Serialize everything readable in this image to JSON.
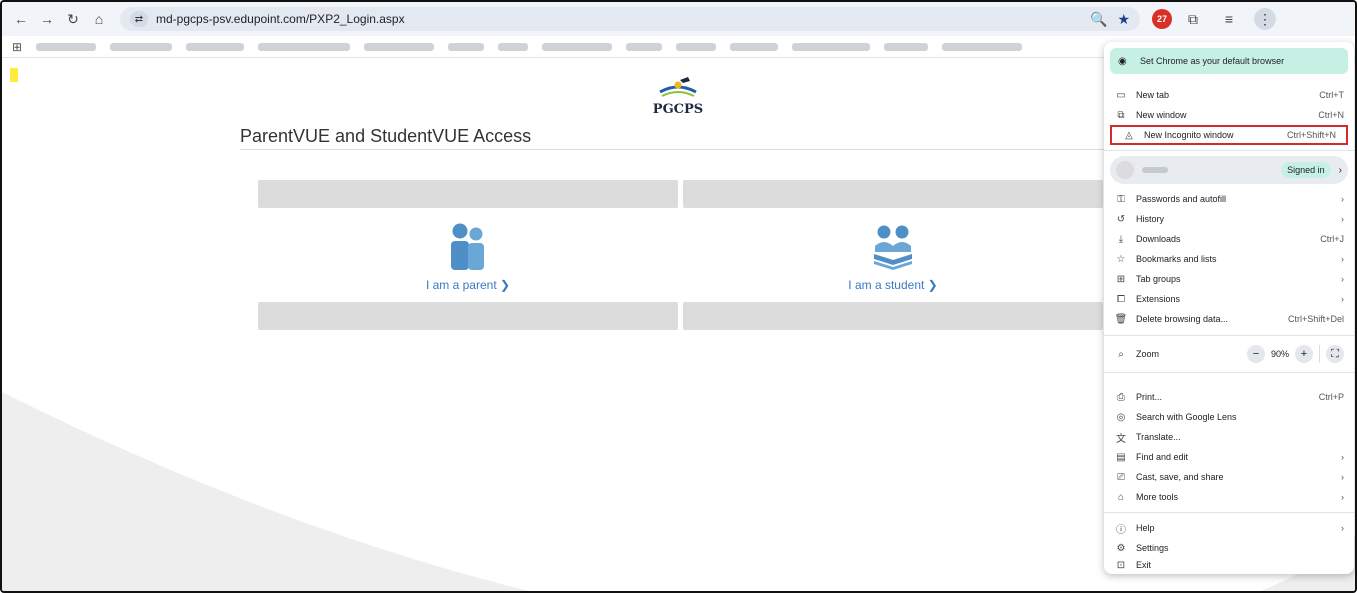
{
  "browser": {
    "url": "md-pgcps-psv.edupoint.com/PXP2_Login.aspx",
    "extension_badge": "27"
  },
  "page": {
    "logo_text": "PGCPS",
    "title": "ParentVUE and StudentVUE Access",
    "parent_link": "I am a parent ❯",
    "student_link": "I am a student ❯"
  },
  "menu": {
    "banner": "Set Chrome as your default browser",
    "new_tab": "New tab",
    "new_tab_sc": "Ctrl+T",
    "new_window": "New window",
    "new_window_sc": "Ctrl+N",
    "incognito": "New Incognito window",
    "incognito_sc": "Ctrl+Shift+N",
    "signed_in": "Signed in",
    "passwords": "Passwords and autofill",
    "history": "History",
    "downloads": "Downloads",
    "downloads_sc": "Ctrl+J",
    "bookmarks": "Bookmarks and lists",
    "tab_groups": "Tab groups",
    "extensions": "Extensions",
    "delete_data": "Delete browsing data...",
    "delete_data_sc": "Ctrl+Shift+Del",
    "zoom": "Zoom",
    "zoom_level": "90%",
    "print": "Print...",
    "print_sc": "Ctrl+P",
    "lens": "Search with Google Lens",
    "translate": "Translate...",
    "find": "Find and edit",
    "cast": "Cast, save, and share",
    "more_tools": "More tools",
    "help": "Help",
    "settings": "Settings",
    "exit": "Exit"
  }
}
